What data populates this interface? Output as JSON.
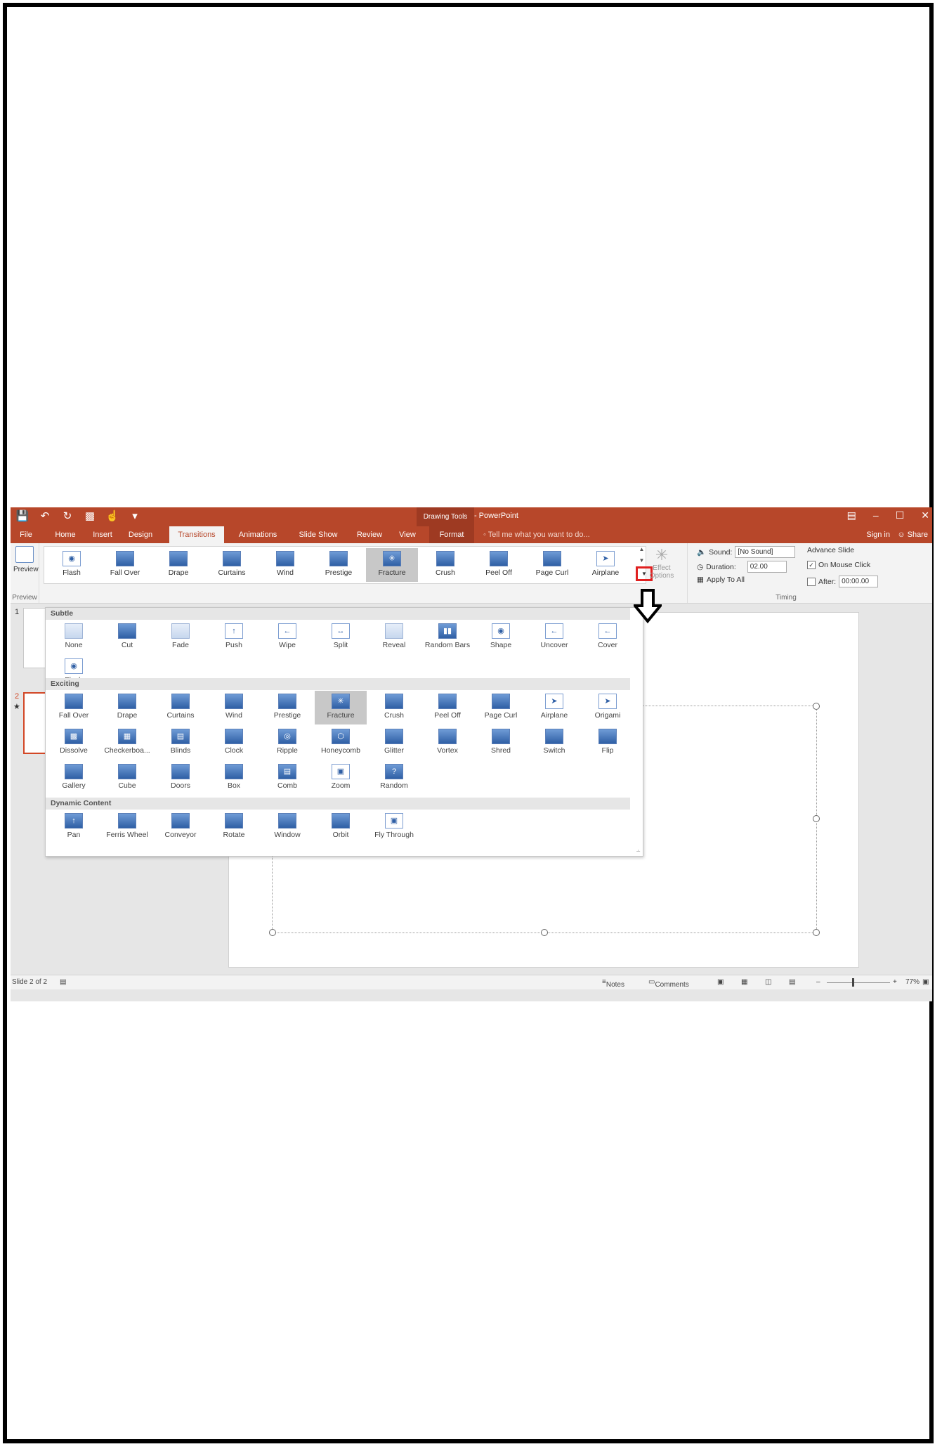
{
  "window": {
    "title": "Presentation1 - PowerPoint",
    "context_tab_group": "Drawing Tools",
    "tabs": [
      "File",
      "Home",
      "Insert",
      "Design",
      "Transitions",
      "Animations",
      "Slide Show",
      "Review",
      "View",
      "Format"
    ],
    "active_tab": "Transitions",
    "tell_me": "Tell me what you want to do...",
    "sign_in": "Sign in",
    "share": "Share"
  },
  "ribbon": {
    "preview_label": "Preview",
    "preview_group": "Preview",
    "gallery_items": [
      "Flash",
      "Fall Over",
      "Drape",
      "Curtains",
      "Wind",
      "Prestige",
      "Fracture",
      "Crush",
      "Peel Off",
      "Page Curl",
      "Airplane"
    ],
    "gallery_selected": "Fracture",
    "effect_options": "Effect Options",
    "timing": {
      "sound_label": "Sound:",
      "sound_value": "[No Sound]",
      "duration_label": "Duration:",
      "duration_value": "02.00",
      "apply_to_all": "Apply To All",
      "advance_slide": "Advance Slide",
      "on_mouse_click": "On Mouse Click",
      "on_mouse_click_checked": true,
      "after_label": "After:",
      "after_value": "00:00.00",
      "group_label": "Timing"
    }
  },
  "dropdown": {
    "sections": [
      {
        "title": "Subtle",
        "items": [
          "None",
          "Cut",
          "Fade",
          "Push",
          "Wipe",
          "Split",
          "Reveal",
          "Random Bars",
          "Shape",
          "Uncover",
          "Cover",
          "Flash"
        ]
      },
      {
        "title": "Exciting",
        "items": [
          "Fall Over",
          "Drape",
          "Curtains",
          "Wind",
          "Prestige",
          "Fracture",
          "Crush",
          "Peel Off",
          "Page Curl",
          "Airplane",
          "Origami",
          "Dissolve",
          "Checkerboa...",
          "Blinds",
          "Clock",
          "Ripple",
          "Honeycomb",
          "Glitter",
          "Vortex",
          "Shred",
          "Switch",
          "Flip",
          "Gallery",
          "Cube",
          "Doors",
          "Box",
          "Comb",
          "Zoom",
          "Random"
        ]
      },
      {
        "title": "Dynamic Content",
        "items": [
          "Pan",
          "Ferris Wheel",
          "Conveyor",
          "Rotate",
          "Window",
          "Orbit",
          "Fly Through"
        ]
      }
    ],
    "selected": "Fracture"
  },
  "thumbnails": {
    "numbers": [
      "1",
      "2"
    ],
    "selected": "2"
  },
  "status": {
    "slide_info": "Slide 2 of 2",
    "notes": "Notes",
    "comments": "Comments",
    "zoom": "77%",
    "zoom_level": 0.77
  },
  "colors": {
    "accent": "#b7472a",
    "highlight": "#e02020"
  }
}
